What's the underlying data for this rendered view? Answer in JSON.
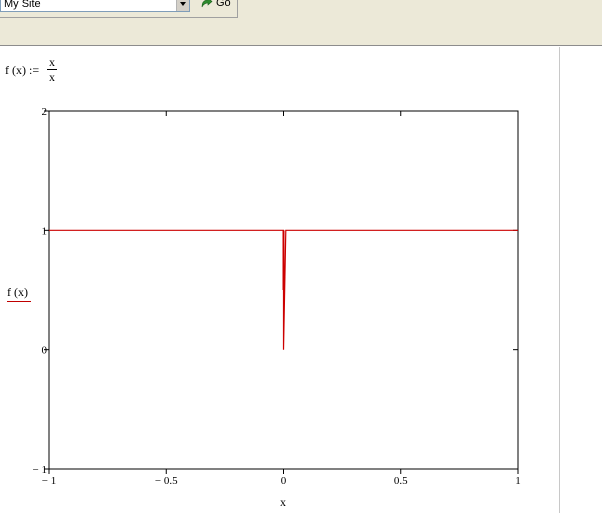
{
  "toolbar": {
    "site_select_value": "My Site",
    "go_label": "Go"
  },
  "worksheet": {
    "definition_lhs": "f (x) :=",
    "definition_numerator": "x",
    "definition_denominator": "x",
    "y_axis_label": "f (x)",
    "x_axis_label": "x"
  },
  "chart_data": {
    "type": "line",
    "title": "",
    "xlabel": "x",
    "ylabel": "f (x)",
    "xlim": [
      -1,
      1
    ],
    "ylim": [
      -1,
      2
    ],
    "x_ticks": [
      -1,
      -0.5,
      0,
      0.5,
      1
    ],
    "x_tick_labels": [
      "− 1",
      "− 0.5",
      "0",
      "0.5",
      "1"
    ],
    "y_ticks": [
      -1,
      0,
      1,
      2
    ],
    "y_tick_labels": [
      "− 1",
      "0",
      "1",
      "2"
    ],
    "grid": false,
    "series": [
      {
        "color": "#cc0000",
        "x": [
          -1,
          -0.01,
          0,
          0,
          0.01,
          1
        ],
        "y": [
          1,
          1,
          1,
          0,
          1,
          1
        ]
      }
    ]
  }
}
